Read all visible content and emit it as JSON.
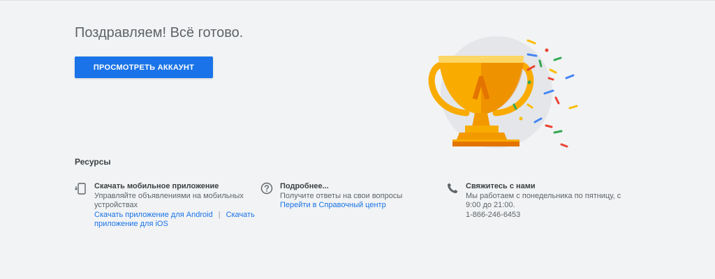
{
  "headline": "Поздравляем! Всё готово.",
  "cta_label": "ПРОСМОТРЕТЬ АККАУНТ",
  "resources_title": "Ресурсы",
  "resources": [
    {
      "icon": "phone-download-icon",
      "title": "Скачать мобильное приложение",
      "desc": "Управляйте объявлениями на мобильных устройствах",
      "link1": "Скачать приложение для Android",
      "separator": "|",
      "link2": "Скачать приложение для iOS"
    },
    {
      "icon": "help-circle-icon",
      "title": "Подробнее...",
      "desc": "Получите ответы на свои вопросы",
      "link1": "Перейти в Справочный центр"
    },
    {
      "icon": "phone-icon",
      "title": "Свяжитесь с нами",
      "desc": "Мы работаем с понедельника по пятницу, с 9:00 до 21:00.",
      "phone": "1-866-246-6453"
    }
  ],
  "colors": {
    "accent": "#1a73e8",
    "background": "#f1f3f4",
    "trophy": "#f9ab00",
    "confetti": [
      "#4285f4",
      "#ea4335",
      "#fbbc04",
      "#34a853"
    ]
  }
}
